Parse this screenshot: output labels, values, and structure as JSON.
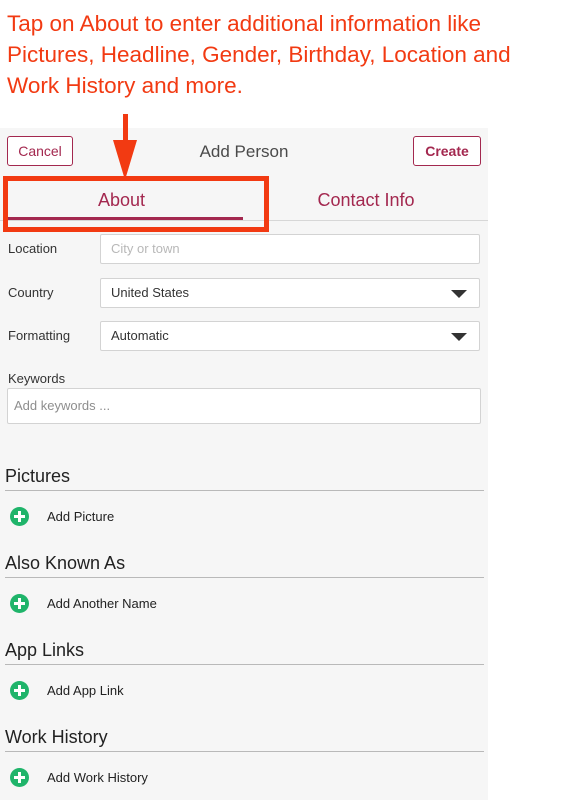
{
  "annotation": "Tap on About to enter additional information like Pictures, Headline, Gender, Birthday, Location and Work History and more.",
  "header": {
    "cancel_label": "Cancel",
    "title": "Add Person",
    "create_label": "Create"
  },
  "tabs": [
    {
      "label": "About",
      "active": true
    },
    {
      "label": "Contact Info",
      "active": false
    }
  ],
  "fields": {
    "location": {
      "label": "Location",
      "placeholder": "City or town"
    },
    "country": {
      "label": "Country",
      "value": "United States"
    },
    "formatting": {
      "label": "Formatting",
      "value": "Automatic"
    },
    "keywords": {
      "label": "Keywords",
      "placeholder": "Add keywords ..."
    }
  },
  "sections": [
    {
      "title": "Pictures",
      "action": "Add Picture"
    },
    {
      "title": "Also Known As",
      "action": "Add Another Name"
    },
    {
      "title": "App Links",
      "action": "Add App Link"
    },
    {
      "title": "Work History",
      "action": "Add Work History"
    }
  ],
  "colors": {
    "accent": "#a3284f",
    "annotation": "#f23a12",
    "add_icon": "#1fb46a"
  }
}
